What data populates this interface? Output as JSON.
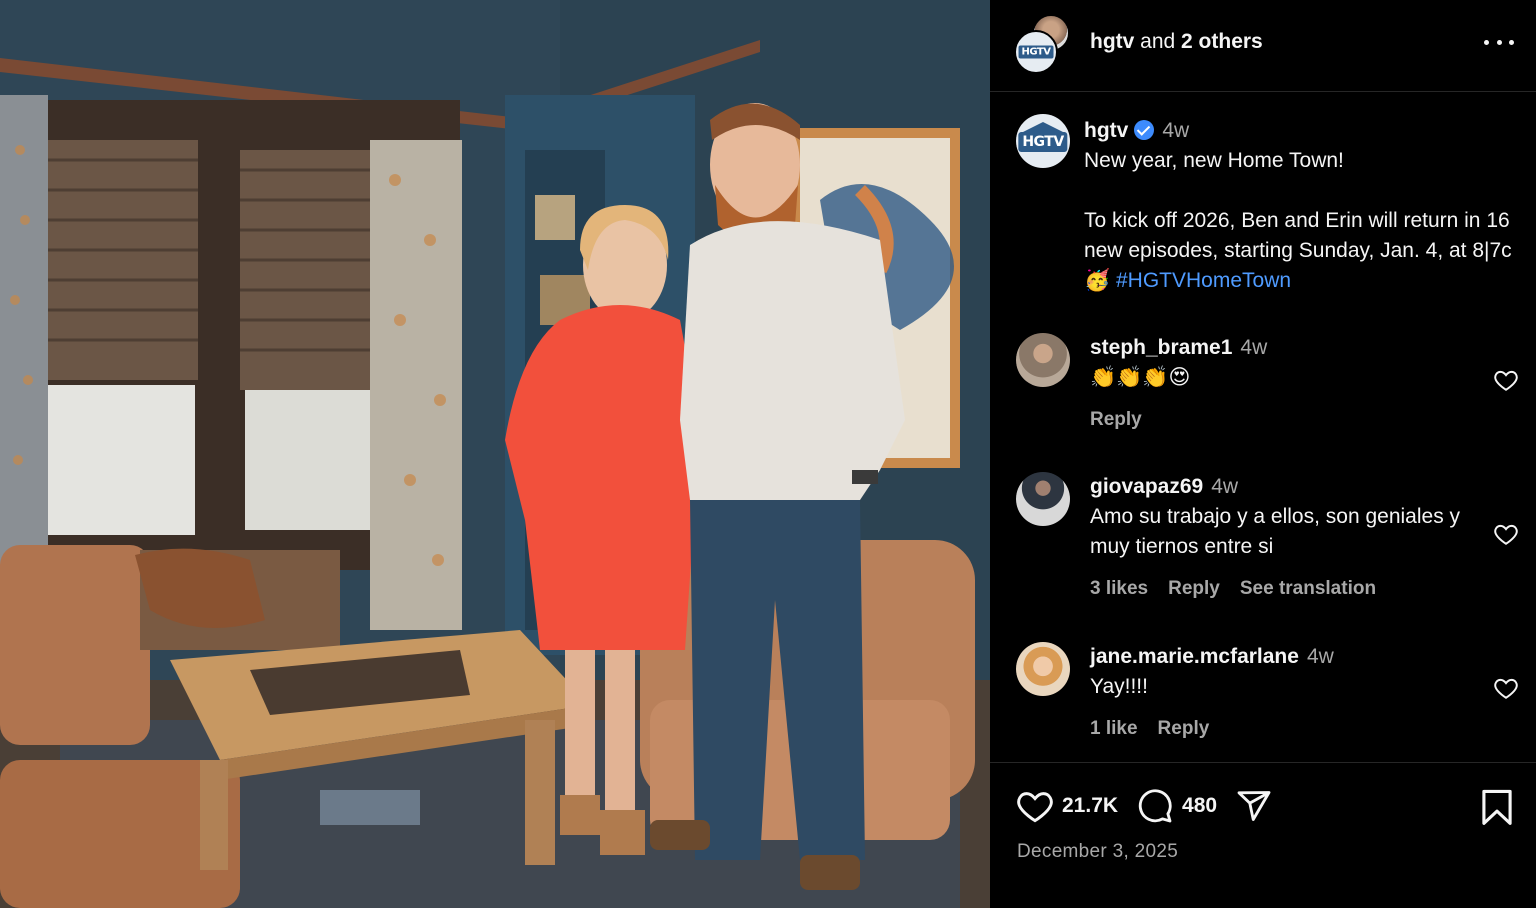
{
  "photo": {
    "alt": "",
    "colors": {
      "dress": "#f2503c",
      "shirt": "#e6e2dc",
      "jeans": "#2f4a63",
      "walls": "#2f4656",
      "chair": "#b9805a"
    }
  },
  "header": {
    "title_user": "hgtv",
    "title_rest": " and ",
    "title_others": "2 others",
    "avatar_text": "HGTV"
  },
  "caption": {
    "avatar_text": "HGTV",
    "username": "hgtv",
    "time": "4w",
    "line1": "New year, new Home Town!",
    "body": "To kick off 2026, Ben and Erin will return in 16 new episodes, starting Sunday, Jan. 4, at 8|7c ",
    "emoji": "🥳",
    "hashtag": "#HGTVHomeTown"
  },
  "comments": [
    {
      "username": "steph_brame1",
      "time": "4w",
      "text": "👏👏👏😍",
      "likes": "",
      "reply": "Reply",
      "translation": ""
    },
    {
      "username": "giovapaz69",
      "time": "4w",
      "text": "Amo su trabajo y a ellos, son geniales y muy tiernos entre si",
      "likes": "3 likes",
      "reply": "Reply",
      "translation": "See translation"
    },
    {
      "username": "jane.marie.mcfarlane",
      "time": "4w",
      "text": "Yay!!!!",
      "likes": "1 like",
      "reply": "Reply",
      "translation": ""
    }
  ],
  "footer": {
    "likes": "21.7K",
    "comments": "480",
    "date": "December 3, 2025"
  },
  "icons": [
    "more-icon",
    "verified-icon",
    "heart-icon",
    "comment-icon",
    "share-icon",
    "bookmark-icon"
  ]
}
